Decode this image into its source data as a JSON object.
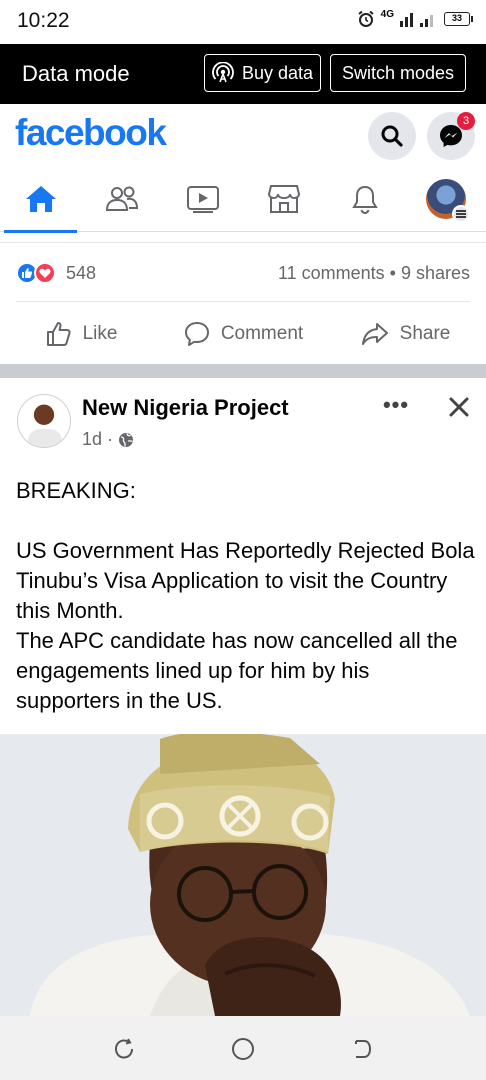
{
  "status_bar": {
    "time": "10:22",
    "network": "4G",
    "battery": "33"
  },
  "data_bar": {
    "title": "Data mode",
    "buy_label": "Buy data",
    "switch_label": "Switch modes"
  },
  "header": {
    "logo": "facebook",
    "messenger_badge": "3",
    "brand_color": "#1877f2"
  },
  "nav": {
    "tabs": [
      "home",
      "friends",
      "watch",
      "marketplace",
      "notifications",
      "menu"
    ],
    "active": "home"
  },
  "prev_post": {
    "reaction_count": "548",
    "engagement": "11 comments • 9 shares",
    "actions": {
      "like": "Like",
      "comment": "Comment",
      "share": "Share"
    }
  },
  "post": {
    "page_name": "New Nigeria Project",
    "time": "1d",
    "meta_separator": "·",
    "more": "•••",
    "text": {
      "line1": "BREAKING:",
      "line2": "US Government Has Reportedly Rejected Bola Tinubu’s Visa Application to visit the Country this Month.",
      "line3": "The APC candidate has now cancelled all the engagements lined up for him by his supporters in the US."
    }
  }
}
